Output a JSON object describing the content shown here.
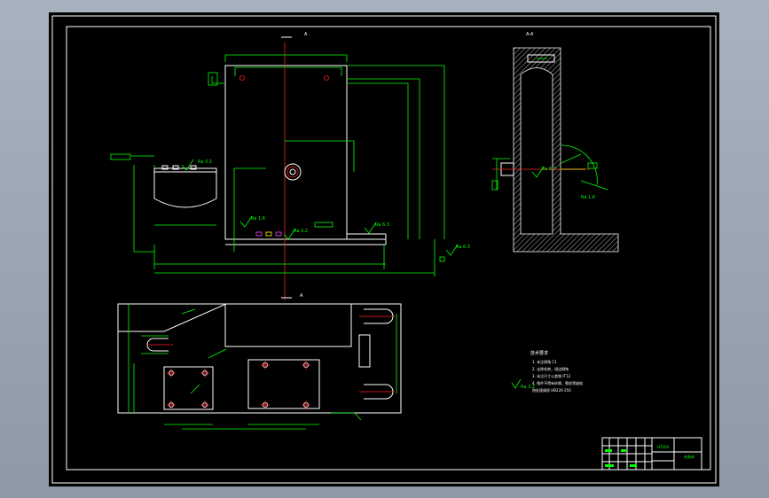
{
  "drawing": {
    "section_label_top": "A",
    "section_label_bottom": "A",
    "section_view_label": "A-A",
    "roughness": {
      "r1": "Ra 3.2",
      "r2": "Ra 1.6",
      "r3": "Ra 3.2",
      "r4": "Ra 6.3",
      "r5": "Ra 6.3",
      "r6": "Ra 6.3",
      "r7": "Ra 1.6",
      "r8": "Ra 3.2"
    },
    "tech_requirements_title": "技术要求",
    "tech_requirements": [
      "1. 未注倒角 C1",
      "2. 去除毛刺，锐边倒钝",
      "3. 未注尺寸公差按 IT12",
      "4. 铸件不得有砂眼、裂纹等缺陷",
      "   热处理调质 HB220-250"
    ]
  },
  "title_block": {
    "part_name": "夹具体",
    "material": "HT200"
  }
}
